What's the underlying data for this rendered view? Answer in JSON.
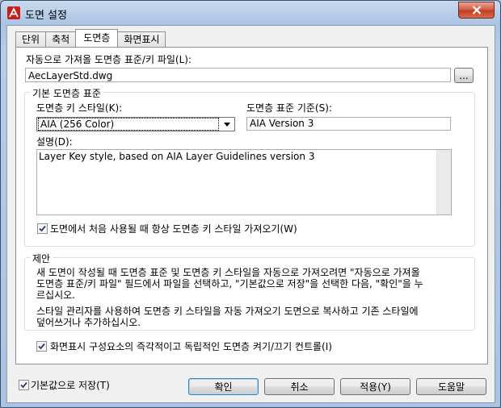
{
  "window": {
    "title": "도면 설정"
  },
  "tabs": [
    {
      "label": "단위",
      "active": false
    },
    {
      "label": "축척",
      "active": false
    },
    {
      "label": "도면층",
      "active": true
    },
    {
      "label": "화면표시",
      "active": false
    }
  ],
  "layer_file": {
    "label": "자동으로 가져올 도면층 표준/키 파일(L):",
    "value": "AecLayerStd.dwg",
    "browse_label": "..."
  },
  "defaults_group": {
    "title": "기본 도면층 표준",
    "key_style_label": "도면층 키 스타일(K):",
    "key_style_value": "AIA (256 Color)",
    "standard_label": "도면층 표준 기준(S):",
    "standard_value": "AIA Version 3",
    "description_label": "설명(D):",
    "description_value": "Layer Key style, based on AIA Layer Guidelines version 3",
    "always_import_label": "도면에서 처음 사용될 때 항상 도면층 키 스타일 가져오기(W)",
    "always_import_checked": true
  },
  "notes_group": {
    "title": "제안",
    "line1": "새 도면이 작성될 때 도면층 표준 및 도면층 키 스타일을 자동으로 가져오려면 \"자동으로 가져올",
    "line2": "도면층 표준/키 파일\" 필드에서 파일을 선택하고, \"기본값으로 저장\"을 선택한 다음, \"확인\"을 누",
    "line3": "르십시오.",
    "line4": "스타일 관리자를 사용하여 도면층 키 스타일을 자동 가져오기 도면으로 복사하고 기존 스타일에",
    "line5": "덮어쓰거나 추가하십시오."
  },
  "display_control": {
    "label": "화면표시 구성요소의 즉각적이고 독립적인 도면층 켜기/끄기 컨트롤(I)",
    "checked": true
  },
  "footer": {
    "save_default_label": "기본값으로 저장(T)",
    "save_default_checked": true,
    "ok_label": "확인",
    "cancel_label": "취소",
    "apply_label": "적용(Y)",
    "help_label": "도움말"
  }
}
